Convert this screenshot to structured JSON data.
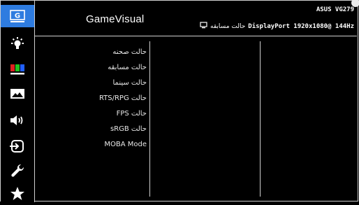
{
  "sidebar": {
    "items": [
      {
        "icon": "gamevisual-g-icon",
        "active": true
      },
      {
        "icon": "blue-light-filter-icon",
        "active": false
      },
      {
        "icon": "color-bars-icon",
        "active": false
      },
      {
        "icon": "image-icon",
        "active": false
      },
      {
        "icon": "sound-icon",
        "active": false
      },
      {
        "icon": "input-select-icon",
        "active": false
      },
      {
        "icon": "system-setup-wrench-icon",
        "active": false
      },
      {
        "icon": "favorite-star-icon",
        "active": false
      }
    ],
    "active_color": "#2e7ce0"
  },
  "header": {
    "title": "GameVisual",
    "model": "ASUS VG279",
    "current_mode": "حالت مسابقه",
    "signal": "DisplayPort 1920x1080@ 144Hz"
  },
  "options": [
    "حالت صحنه",
    "حالت مسابقه",
    "حالت سینما",
    "RTS/RPG حالت",
    "FPS حالت",
    "sRGB حالت",
    "MOBA Mode"
  ]
}
